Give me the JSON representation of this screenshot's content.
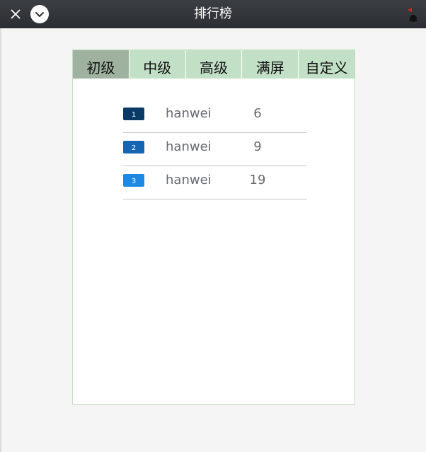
{
  "window": {
    "title": "排行榜"
  },
  "tabs": [
    {
      "label": "初级",
      "active": true
    },
    {
      "label": "中级",
      "active": false
    },
    {
      "label": "高级",
      "active": false
    },
    {
      "label": "满屏",
      "active": false
    },
    {
      "label": "自定义",
      "active": false
    }
  ],
  "colors": {
    "tab_active": "#9fb29f",
    "tab_inactive": "#c2e0c6",
    "rank_colors": [
      "#0a3a66",
      "#1565b3",
      "#1e88e5"
    ]
  },
  "leaderboard": [
    {
      "rank": "1",
      "name": "hanwei",
      "score": "6"
    },
    {
      "rank": "2",
      "name": "hanwei",
      "score": "9"
    },
    {
      "rank": "3",
      "name": "hanwei",
      "score": "19"
    }
  ]
}
